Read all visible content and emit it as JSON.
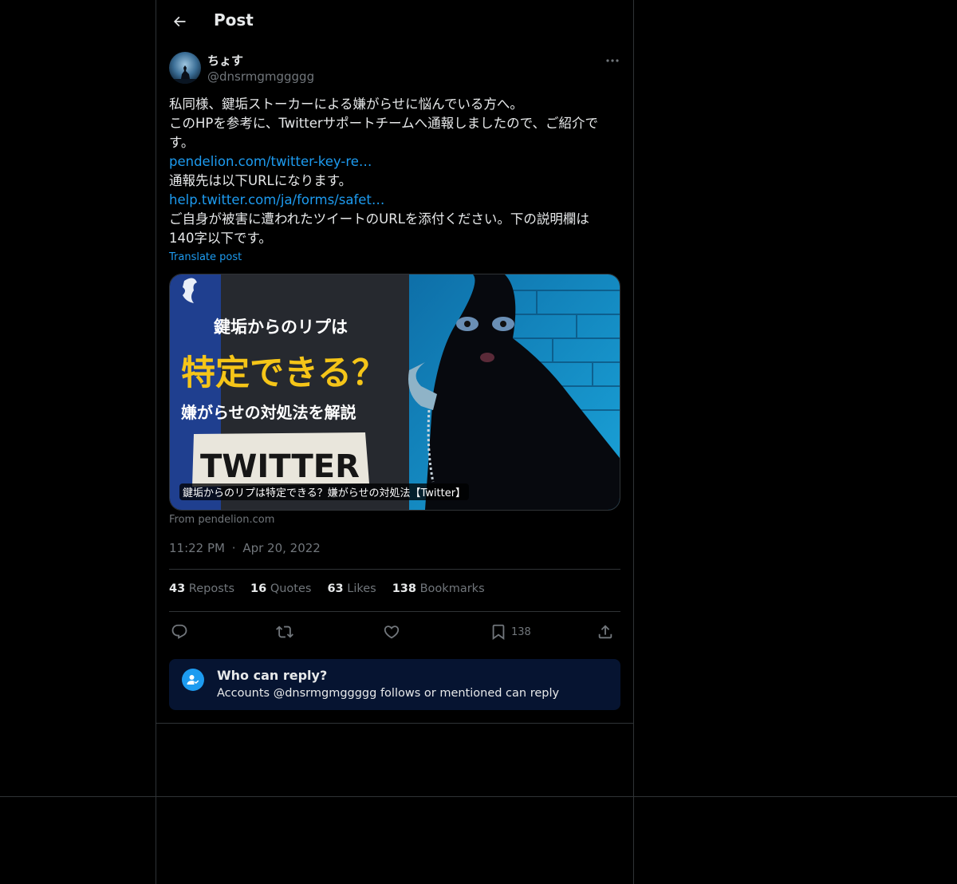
{
  "header": {
    "title": "Post"
  },
  "post": {
    "author": {
      "display_name": "ちょす",
      "handle": "@dnsrmgmggggg"
    },
    "text_lines": [
      "私同様、鍵垢ストーカーによる嫌がらせに悩んでいる方へ。",
      "このHPを参考に、Twitterサポートチームへ通報しましたので、ご紹介で",
      "す。"
    ],
    "link1": "pendelion.com/twitter-key-re…",
    "line_after_link1": "通報先は以下URLになります。",
    "link2": "help.twitter.com/ja/forms/safet…",
    "closing_lines": [
      "ご自身が被害に遭われたツイートのURLを添付ください。下の説明欄は",
      "140字以下です。"
    ],
    "translate_label": "Translate post",
    "card": {
      "image_lines": {
        "line1": "鍵垢からのリプは",
        "line2": "特定できる？",
        "line3": "嫌がらせの対処法を解説",
        "badge": "TWITTER"
      },
      "caption": "鍵垢からのリプは特定できる？嫌がらせの対処法【Twitter】",
      "source": "From pendelion.com"
    },
    "time": "11:22 PM",
    "dot": "·",
    "date": "Apr 20, 2022",
    "stats": {
      "reposts_count": "43",
      "reposts_label": "Reposts",
      "quotes_count": "16",
      "quotes_label": "Quotes",
      "likes_count": "63",
      "likes_label": "Likes",
      "bookmarks_count": "138",
      "bookmarks_label": "Bookmarks"
    },
    "actions": {
      "bookmark_count": "138"
    },
    "reply_restriction": {
      "title": "Who can reply?",
      "subtitle": "Accounts @dnsrmgmggggg follows or mentioned can reply"
    }
  },
  "colors": {
    "background": "#000000",
    "accent": "#1d9bf0",
    "secondary_text": "#71767b",
    "card_yellow": "#f5c518"
  }
}
